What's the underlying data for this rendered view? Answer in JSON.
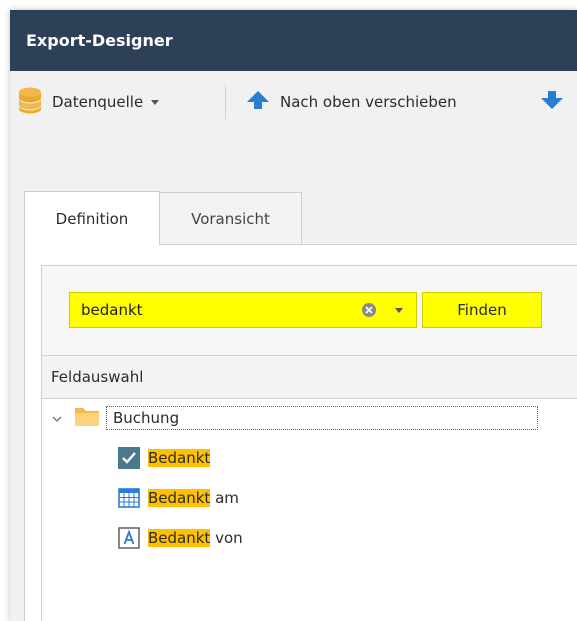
{
  "window": {
    "title": "Export-Designer"
  },
  "toolbar": {
    "datasource_label": "Datenquelle",
    "move_up_label": "Nach oben verschieben"
  },
  "tabs": [
    {
      "label": "Definition",
      "active": true
    },
    {
      "label": "Voransicht",
      "active": false
    }
  ],
  "search": {
    "value": "bedankt",
    "find_label": "Finden",
    "highlight_color": "#ffff00"
  },
  "field_selection": {
    "header": "Feldauswahl"
  },
  "tree": {
    "root": {
      "label": "Buchung",
      "icon": "folder-icon",
      "expanded": true
    },
    "children": [
      {
        "match": "Bedankt",
        "rest": "",
        "icon": "checkbox-icon"
      },
      {
        "match": "Bedankt",
        "rest": " am",
        "icon": "calendar-icon"
      },
      {
        "match": "Bedankt",
        "rest": " von",
        "icon": "text-field-icon"
      }
    ],
    "match_highlight_color": "#ffc000"
  },
  "colors": {
    "titlebar": "#2e4057",
    "accent_blue": "#2b7cd3"
  }
}
